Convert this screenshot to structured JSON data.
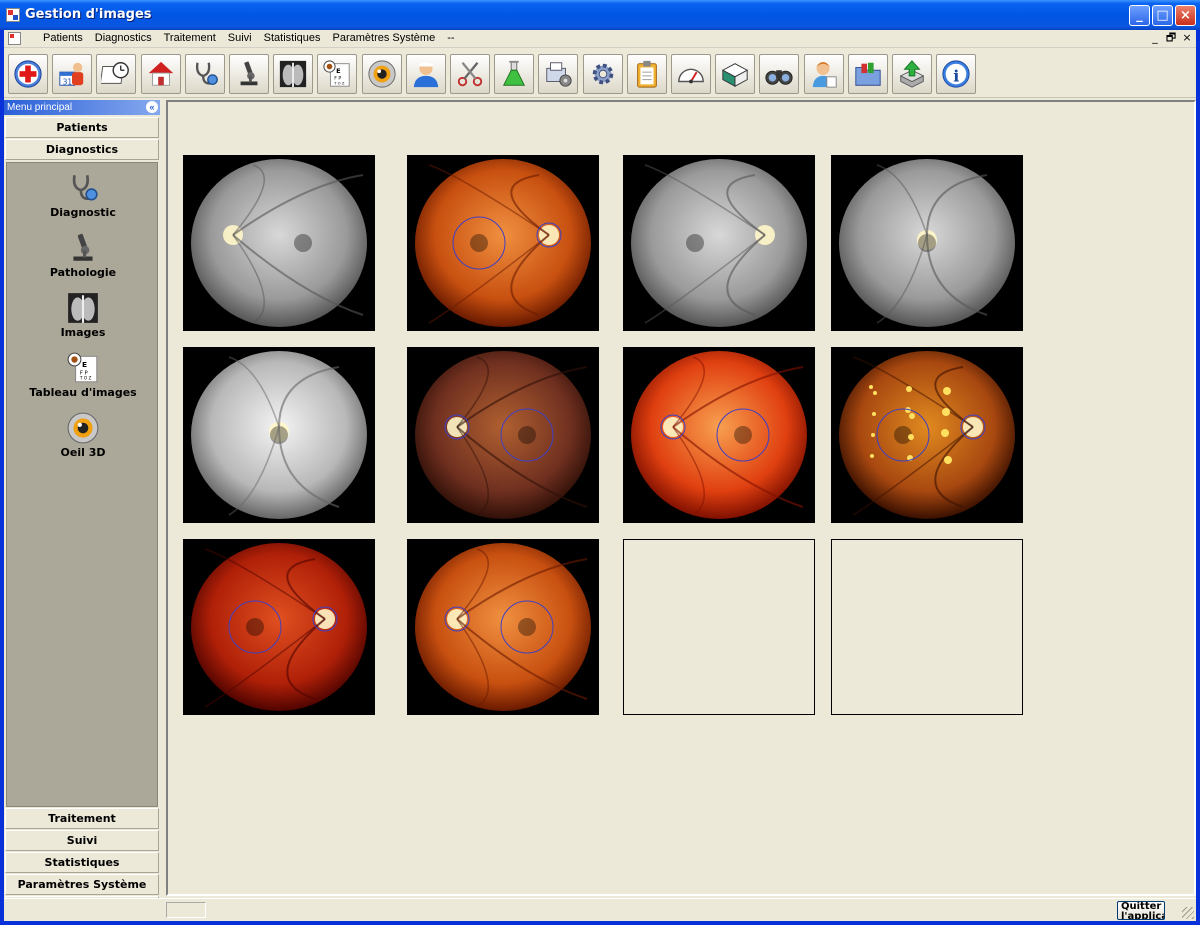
{
  "window": {
    "title": "Gestion d'images"
  },
  "menu": {
    "items": [
      "Patients",
      "Diagnostics",
      "Traitement",
      "Suivi",
      "Statistiques",
      "Paramètres Système",
      "--"
    ],
    "mdi_controls": [
      "_",
      "🗗",
      "×"
    ]
  },
  "toolbar": {
    "icons": [
      "red-cross-icon",
      "patient-calendar-icon",
      "appointment-clock-icon",
      "home-icon",
      "stethoscope-icon",
      "microscope-icon",
      "xray-lungs-icon",
      "eye-chart-icon",
      "eye-3d-icon",
      "doctor-icon",
      "scissors-icon",
      "flask-icon",
      "print-settings-icon",
      "gear-icon",
      "clipboard-icon",
      "gauge-icon",
      "book-icon",
      "binoculars-icon",
      "nurse-icon",
      "folder-icon",
      "upload-icon",
      "info-icon"
    ]
  },
  "sidebar": {
    "header": "Menu principal",
    "top_sections": [
      "Patients",
      "Diagnostics"
    ],
    "items": [
      {
        "label": "Diagnostic",
        "icon": "stethoscope-icon"
      },
      {
        "label": "Pathologie",
        "icon": "microscope-icon"
      },
      {
        "label": "Images",
        "icon": "xray-lungs-icon"
      },
      {
        "label": "Tableau d'images",
        "icon": "eye-chart-icon"
      },
      {
        "label": "Oeil 3D",
        "icon": "eye-3d-icon"
      }
    ],
    "bottom_sections": [
      "Traitement",
      "Suivi",
      "Statistiques",
      "Paramètres Système",
      "—"
    ]
  },
  "gallery": {
    "thumbnails": [
      {
        "kind": "gray",
        "disc": "left"
      },
      {
        "kind": "orange",
        "disc": "right",
        "circle": true
      },
      {
        "kind": "gray",
        "disc": "right"
      },
      {
        "kind": "gray",
        "disc": "center"
      },
      {
        "kind": "gray-bright",
        "disc": "center"
      },
      {
        "kind": "dark-orange",
        "disc": "left",
        "circle": true
      },
      {
        "kind": "bright-red",
        "disc": "left",
        "circle": true
      },
      {
        "kind": "yellow-spots",
        "disc": "right",
        "circle": true
      },
      {
        "kind": "deep-red",
        "disc": "right",
        "circle": true
      },
      {
        "kind": "orange",
        "disc": "left",
        "circle": true
      },
      {
        "kind": "empty"
      },
      {
        "kind": "empty"
      }
    ]
  },
  "status": {
    "quit_label": "Quitter l'application"
  },
  "colors": {
    "title_blue": "#0055e5",
    "sidebar_panel": "#aca899",
    "form_bg": "#ece9d8"
  }
}
